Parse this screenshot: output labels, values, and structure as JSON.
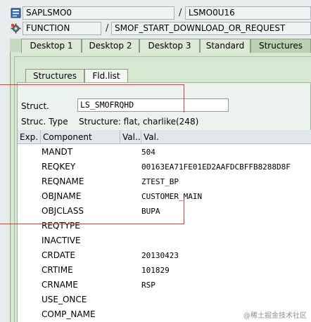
{
  "header": {
    "program": "SAPLSMO0",
    "screen": "LSMO0U16",
    "type": "FUNCTION",
    "name": "SMOF_START_DOWNLOAD_OR_REQUEST"
  },
  "tabs": [
    {
      "label": "Desktop 1"
    },
    {
      "label": "Desktop 2"
    },
    {
      "label": "Desktop 3"
    },
    {
      "label": "Standard"
    },
    {
      "label": "Structures"
    }
  ],
  "inner_tabs": [
    {
      "label": "Structures"
    },
    {
      "label": "Fld.list"
    }
  ],
  "form": {
    "struct_label": "Struct.",
    "struct_value": "LS_SMOFRQHD",
    "type_label": "Struc. Type",
    "type_value": "Structure: flat, charlike(248)"
  },
  "table": {
    "columns": [
      "Exp.",
      "Component",
      "Val...",
      "Val."
    ],
    "rows": [
      {
        "component": "MANDT",
        "value": "504"
      },
      {
        "component": "REQKEY",
        "value": "00163EA71FE01ED2AAFDCBFFB8288D8F"
      },
      {
        "component": "REQNAME",
        "value": "ZTEST_BP"
      },
      {
        "component": "OBJNAME",
        "value": "CUSTOMER_MAIN"
      },
      {
        "component": "OBJCLASS",
        "value": "BUPA"
      },
      {
        "component": "REQTYPE",
        "value": ""
      },
      {
        "component": "INACTIVE",
        "value": ""
      },
      {
        "component": "CRDATE",
        "value": "20130423"
      },
      {
        "component": "CRTIME",
        "value": "101829"
      },
      {
        "component": "CRNAME",
        "value": "RSP"
      },
      {
        "component": "USE_ONCE",
        "value": ""
      },
      {
        "component": "COMP_NAME",
        "value": ""
      }
    ]
  },
  "watermark": "@稀土掘金技术社区",
  "colors": {
    "tab_active": "#b9d3b0",
    "panel_green": "#d7e8d0",
    "annotation_red": "#d43a3a"
  }
}
